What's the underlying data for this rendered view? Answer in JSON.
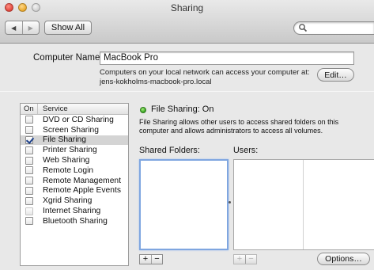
{
  "window": {
    "title": "Sharing"
  },
  "toolbar": {
    "back_icon": "back-arrow-icon",
    "forward_icon": "forward-arrow-icon",
    "show_all_label": "Show All",
    "search_placeholder": "",
    "search_icon": "magnifier-icon"
  },
  "computer_name": {
    "label": "Computer Name:",
    "value": "MacBook Pro",
    "description": "Computers on your local network can access your computer at: jens-kokholms-macbook-pro.local",
    "edit_label": "Edit…"
  },
  "services": {
    "header_on": "On",
    "header_service": "Service",
    "items": [
      {
        "label": "DVD or CD Sharing",
        "checked": false,
        "selected": false,
        "dim": false
      },
      {
        "label": "Screen Sharing",
        "checked": false,
        "selected": false,
        "dim": false
      },
      {
        "label": "File Sharing",
        "checked": true,
        "selected": true,
        "dim": false
      },
      {
        "label": "Printer Sharing",
        "checked": false,
        "selected": false,
        "dim": false
      },
      {
        "label": "Web Sharing",
        "checked": false,
        "selected": false,
        "dim": false
      },
      {
        "label": "Remote Login",
        "checked": false,
        "selected": false,
        "dim": false
      },
      {
        "label": "Remote Management",
        "checked": false,
        "selected": false,
        "dim": false
      },
      {
        "label": "Remote Apple Events",
        "checked": false,
        "selected": false,
        "dim": false
      },
      {
        "label": "Xgrid Sharing",
        "checked": false,
        "selected": false,
        "dim": false
      },
      {
        "label": "Internet Sharing",
        "checked": false,
        "selected": false,
        "dim": true
      },
      {
        "label": "Bluetooth Sharing",
        "checked": false,
        "selected": false,
        "dim": false
      }
    ]
  },
  "detail": {
    "status": "File Sharing: On",
    "status_color": "#35a220",
    "description": "File Sharing allows other users to access shared folders on this computer and allows administrators to access all volumes.",
    "shared_folders_label": "Shared Folders:",
    "users_label": "Users:",
    "add_symbol": "+",
    "remove_symbol": "−",
    "options_label": "Options…"
  }
}
